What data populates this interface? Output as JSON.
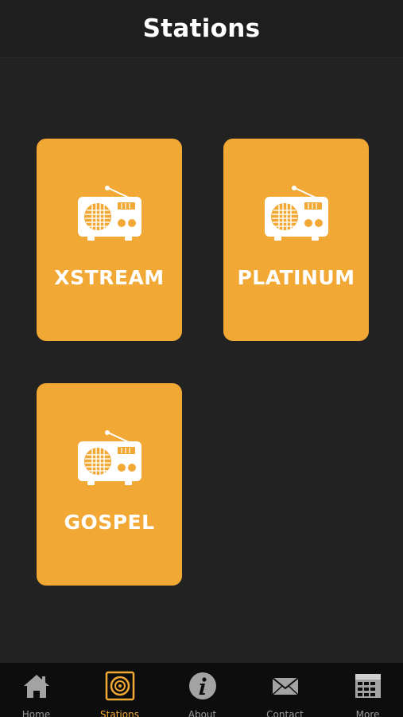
{
  "header": {
    "title": "Stations"
  },
  "stations": [
    {
      "label": "XSTREAM",
      "icon": "radio-icon"
    },
    {
      "label": "PLATINUM",
      "icon": "radio-icon"
    },
    {
      "label": "GOSPEL",
      "icon": "radio-icon"
    }
  ],
  "tab_bar": {
    "active_index": 1,
    "tabs": [
      {
        "icon": "home-icon",
        "label": "Home"
      },
      {
        "icon": "speaker-icon",
        "label": "Stations"
      },
      {
        "icon": "info-icon",
        "label": "About"
      },
      {
        "icon": "mail-icon",
        "label": "Contact"
      },
      {
        "icon": "calendar-icon",
        "label": "More"
      }
    ]
  },
  "colors": {
    "background": "#222222",
    "tile": "#f2a834",
    "tab_bar": "#0d0d0d",
    "tab_icon": "#a3a3a3",
    "accent": "#f2a834"
  }
}
